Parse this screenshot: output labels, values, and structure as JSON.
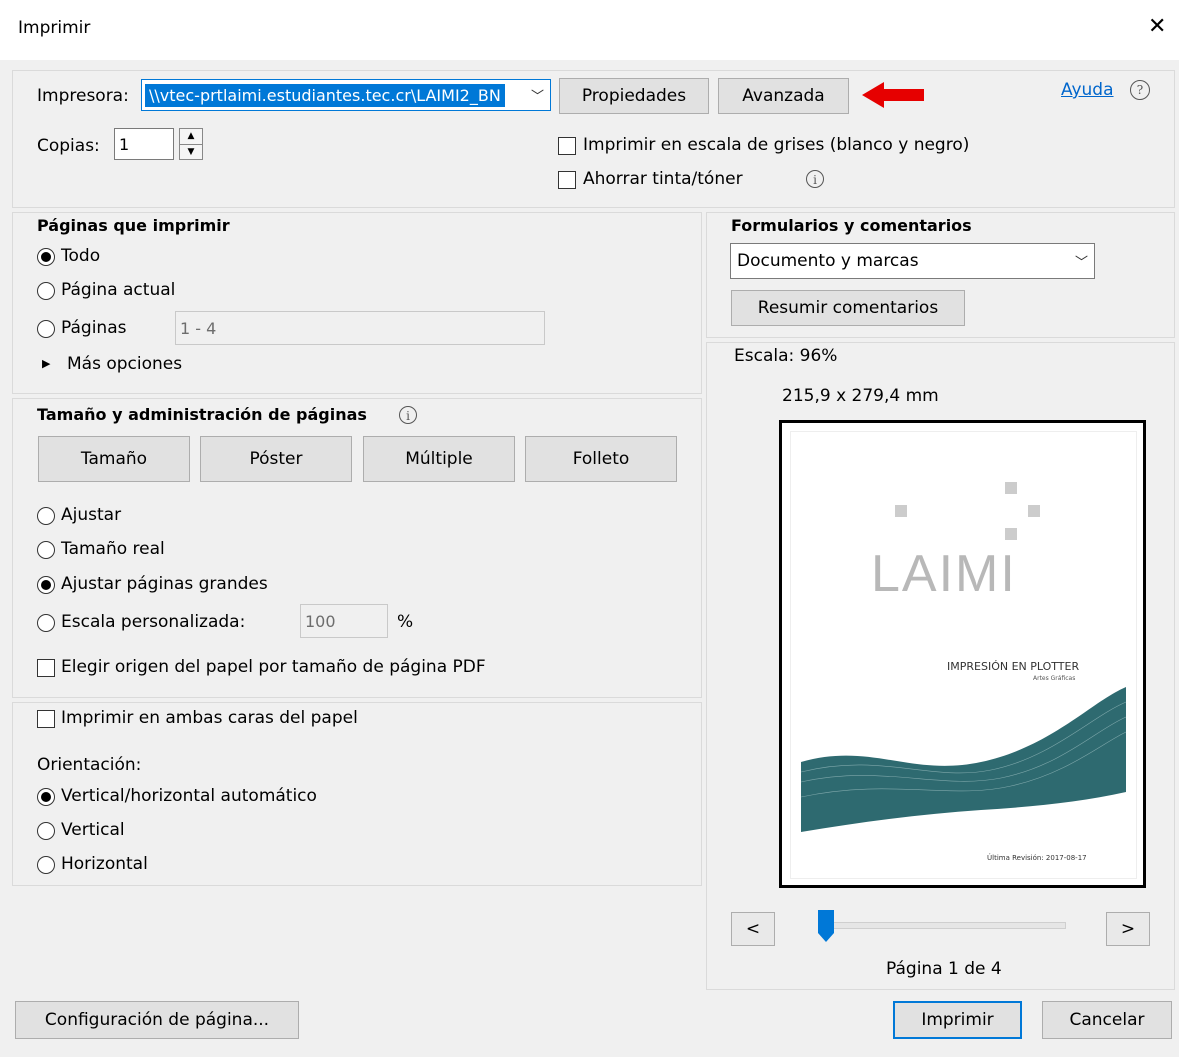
{
  "window": {
    "title": "Imprimir",
    "close_glyph": "✕"
  },
  "printer": {
    "label": "Impresora:",
    "selected": "\\\\vtec-prtlaimi.estudiantes.tec.cr\\LAIMI2_BN",
    "properties_label": "Propiedades",
    "advanced_label": "Avanzada",
    "help_label": "Ayuda",
    "help_glyph": "?"
  },
  "copies": {
    "label": "Copias:",
    "value": "1"
  },
  "options": {
    "grayscale_label": "Imprimir en escala de grises (blanco y negro)",
    "save_ink_label": "Ahorrar tinta/tóner"
  },
  "pages": {
    "title": "Páginas que imprimir",
    "all_label": "Todo",
    "current_label": "Página actual",
    "pages_label": "Páginas",
    "pages_value": "1 - 4",
    "more_label": "Más opciones"
  },
  "size": {
    "title": "Tamaño y administración de páginas",
    "tabs": [
      "Tamaño",
      "Póster",
      "Múltiple",
      "Folleto"
    ],
    "fit_label": "Ajustar",
    "actual_label": "Tamaño real",
    "shrink_label": "Ajustar páginas grandes",
    "custom_label": "Escala personalizada:",
    "custom_value": "100",
    "percent": "%",
    "paper_source_label": "Elegir origen del papel por tamaño de página PDF"
  },
  "duplex": {
    "both_sides_label": "Imprimir en ambas caras del papel",
    "orientation_label": "Orientación:",
    "auto_label": "Vertical/horizontal automático",
    "portrait_label": "Vertical",
    "landscape_label": "Horizontal"
  },
  "forms": {
    "title": "Formularios y comentarios",
    "selected": "Documento y marcas",
    "summarize_label": "Resumir comentarios"
  },
  "preview": {
    "scale_text": "Escala:  96%",
    "dimensions": "215,9 x 279,4 mm",
    "doc_logo": "LAIMI",
    "doc_title": "IMPRESIÓN EN PLOTTER",
    "doc_subtitle": "Artes Gráficas",
    "doc_footer": "Última Revisión: 2017-08-17",
    "prev_label": "<",
    "next_label": ">",
    "page_indicator": "Página 1 de 4",
    "slider_fraction": 0.0
  },
  "footer": {
    "page_setup_label": "Configuración de página...",
    "print_label": "Imprimir",
    "cancel_label": "Cancelar"
  },
  "colors": {
    "accent": "#0078d7",
    "selection": "#0078d7",
    "arrow": "#e60000",
    "wave": "#2e6a70"
  }
}
